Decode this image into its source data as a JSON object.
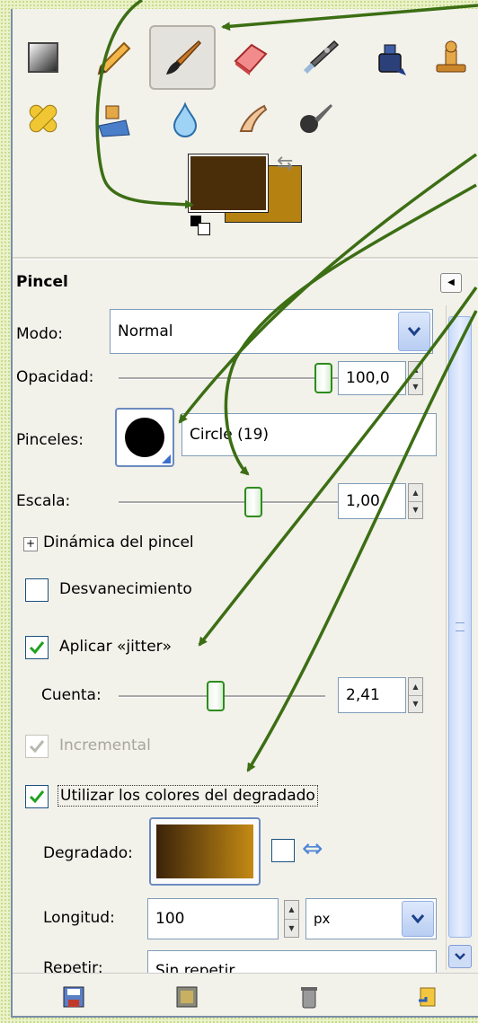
{
  "colors": {
    "foreground": "#4a2e0a",
    "background": "#b58212",
    "accent_green": "#3c6e14",
    "gradient_start": "#3b230a",
    "gradient_end": "#c48a14"
  },
  "toolbox": {
    "tools": [
      {
        "name": "blend-tool",
        "icon": "blend-icon",
        "active": false
      },
      {
        "name": "pencil-tool",
        "icon": "pencil-icon",
        "active": false
      },
      {
        "name": "paintbrush-tool",
        "icon": "paintbrush-icon",
        "active": true
      },
      {
        "name": "eraser-tool",
        "icon": "eraser-icon",
        "active": false
      },
      {
        "name": "airbrush-tool",
        "icon": "airbrush-icon",
        "active": false
      },
      {
        "name": "ink-tool",
        "icon": "ink-icon",
        "active": false
      },
      {
        "name": "clone-tool",
        "icon": "clone-stamp-icon",
        "active": false
      },
      {
        "name": "heal-tool",
        "icon": "bandage-icon",
        "active": false
      },
      {
        "name": "perspective-clone-tool",
        "icon": "perspective-clone-icon",
        "active": false
      },
      {
        "name": "blur-tool",
        "icon": "water-drop-icon",
        "active": false
      },
      {
        "name": "smudge-tool",
        "icon": "smudge-finger-icon",
        "active": false
      },
      {
        "name": "dodge-burn-tool",
        "icon": "dodge-burn-icon",
        "active": false
      }
    ]
  },
  "options": {
    "title": "Pincel",
    "mode": {
      "label": "Modo:",
      "value": "Normal"
    },
    "opacity": {
      "label": "Opacidad:",
      "value": "100,0",
      "fraction": 1.0
    },
    "brush": {
      "label": "Pinceles:",
      "value": "Circle (19)"
    },
    "scale": {
      "label": "Escala:",
      "value": "1,00",
      "fraction": 0.5
    },
    "dynamics": {
      "label": "Dinámica del pincel",
      "expander": "+"
    },
    "fade": {
      "label": "Desvanecimiento",
      "checked": false
    },
    "jitter": {
      "label": "Aplicar «jitter»",
      "checked": true
    },
    "amount": {
      "label": "Cuenta:",
      "value": "2,41",
      "fraction": 0.48
    },
    "incremental": {
      "label": "Incremental",
      "checked": true,
      "disabled": true
    },
    "use_gradient": {
      "label": "Utilizar los colores del degradado",
      "checked": true
    },
    "gradient": {
      "label": "Degradado:"
    },
    "length": {
      "label": "Longitud:",
      "value": "100",
      "unit": "px"
    },
    "repeat": {
      "label": "Repetir:",
      "value": "Sin repetir"
    }
  }
}
